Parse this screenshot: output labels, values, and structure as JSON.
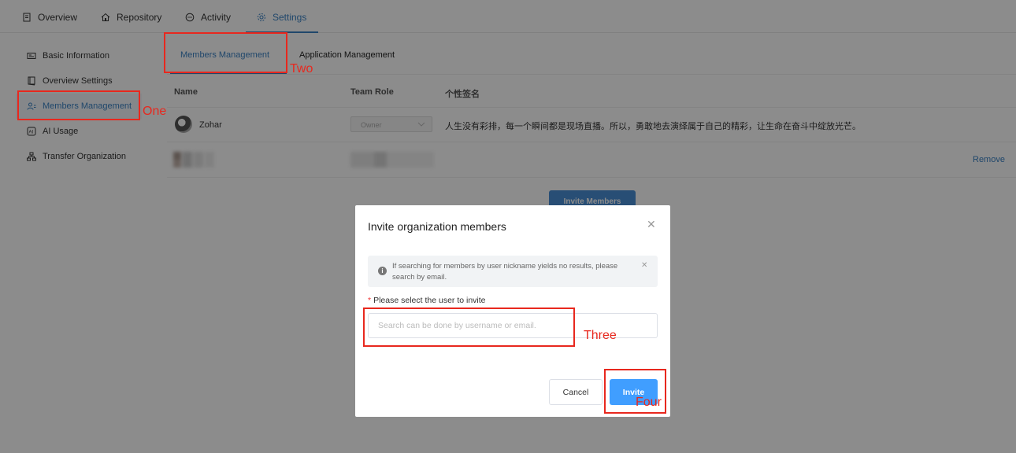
{
  "topnav": {
    "tabs": [
      {
        "label": "Overview",
        "icon": "document-icon"
      },
      {
        "label": "Repository",
        "icon": "home-icon"
      },
      {
        "label": "Activity",
        "icon": "chat-icon"
      },
      {
        "label": "Settings",
        "icon": "gear-icon",
        "active": true
      }
    ]
  },
  "sidebar": {
    "items": [
      {
        "label": "Basic Information",
        "icon": "id-card-icon"
      },
      {
        "label": "Overview Settings",
        "icon": "book-icon"
      },
      {
        "label": "Members Management",
        "icon": "users-icon",
        "active": true
      },
      {
        "label": "AI Usage",
        "icon": "ai-icon"
      },
      {
        "label": "Transfer Organization",
        "icon": "org-chart-icon"
      }
    ]
  },
  "subtabs": {
    "members": "Members Management",
    "application": "Application Management"
  },
  "table": {
    "headers": [
      "Name",
      "Team Role",
      "个性签名"
    ],
    "rows": [
      {
        "name": "Zohar",
        "role": "Owner",
        "signature": "人生没有彩排，每一个瞬间都是现场直播。所以，勇敢地去演绎属于自己的精彩，让生命在奋斗中绽放光芒。"
      },
      {
        "name": "",
        "role": "",
        "signature": "",
        "action": "Remove"
      }
    ]
  },
  "invite_members_button": "Invite Members",
  "modal": {
    "title": "Invite organization members",
    "alert": "If searching for members by user nickname yields no results, please search by email.",
    "field_label": "Please select the user to invite",
    "field_required_mark": "*",
    "search_placeholder": "Search can be done by username or email.",
    "cancel": "Cancel",
    "invite": "Invite"
  },
  "annotations": {
    "one": "One",
    "two": "Two",
    "three": "Three",
    "four": "Four",
    "color": "#e8281e"
  },
  "colors": {
    "accent": "#3b82c4",
    "primary_button": "#409eff"
  }
}
